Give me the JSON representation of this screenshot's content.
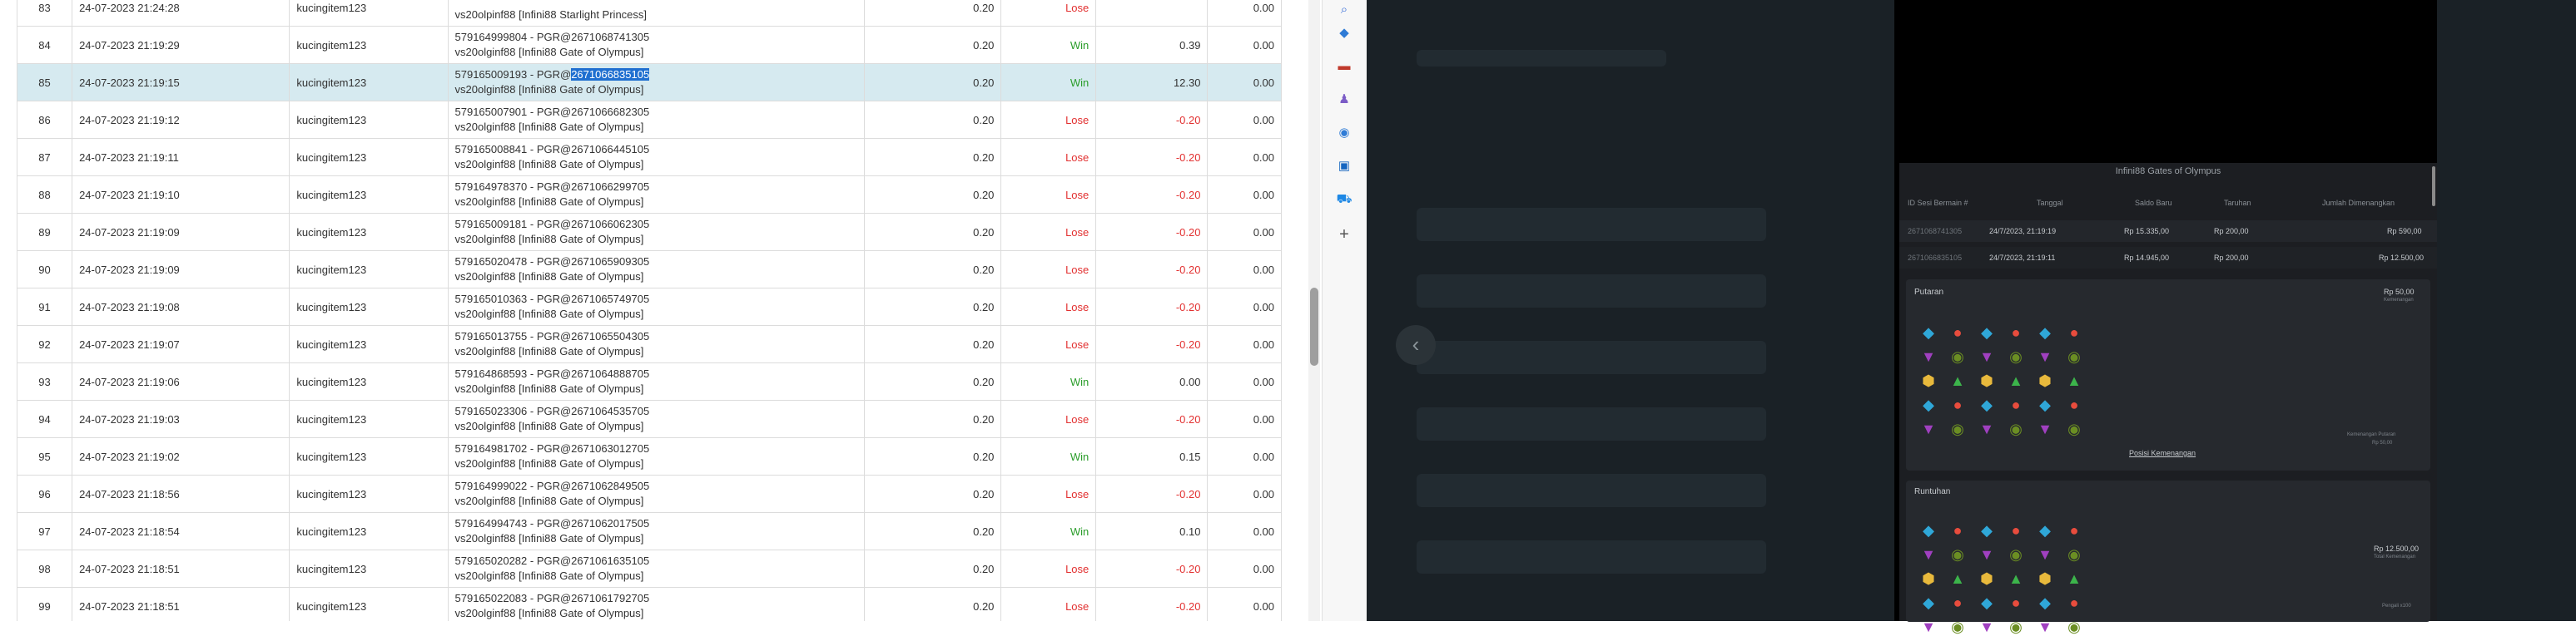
{
  "table": {
    "rows": [
      {
        "no": "83",
        "datetime": "24-07-2023 21:24:28",
        "user": "kucingitem123",
        "desc1": "",
        "desc2": "vs20olpinf88 [Infini88 Starlight Princess]",
        "bet": "0.20",
        "result": "Lose",
        "winloss": "",
        "balance": "0.00"
      },
      {
        "no": "84",
        "datetime": "24-07-2023 21:19:29",
        "user": "kucingitem123",
        "desc1": "579164999804 - PGR@2671068741305",
        "desc2": "vs20olginf88 [Infini88 Gate of Olympus]",
        "bet": "0.20",
        "result": "Win",
        "winloss": "0.39",
        "balance": "0.00"
      },
      {
        "no": "85",
        "datetime": "24-07-2023 21:19:15",
        "user": "kucingitem123",
        "desc1a": "579165009193 - PGR@",
        "desc1b": "2671066835105",
        "desc2": "vs20olginf88 [Infini88 Gate of Olympus]",
        "bet": "0.20",
        "result": "Win",
        "winloss": "12.30",
        "balance": "0.00"
      },
      {
        "no": "86",
        "datetime": "24-07-2023 21:19:12",
        "user": "kucingitem123",
        "desc1": "579165007901 - PGR@2671066682305",
        "desc2": "vs20olginf88 [Infini88 Gate of Olympus]",
        "bet": "0.20",
        "result": "Lose",
        "winloss": "-0.20",
        "balance": "0.00"
      },
      {
        "no": "87",
        "datetime": "24-07-2023 21:19:11",
        "user": "kucingitem123",
        "desc1": "579165008841 - PGR@2671066445105",
        "desc2": "vs20olginf88 [Infini88 Gate of Olympus]",
        "bet": "0.20",
        "result": "Lose",
        "winloss": "-0.20",
        "balance": "0.00"
      },
      {
        "no": "88",
        "datetime": "24-07-2023 21:19:10",
        "user": "kucingitem123",
        "desc1": "579164978370 - PGR@2671066299705",
        "desc2": "vs20olginf88 [Infini88 Gate of Olympus]",
        "bet": "0.20",
        "result": "Lose",
        "winloss": "-0.20",
        "balance": "0.00"
      },
      {
        "no": "89",
        "datetime": "24-07-2023 21:19:09",
        "user": "kucingitem123",
        "desc1": "579165009181 - PGR@2671066062305",
        "desc2": "vs20olginf88 [Infini88 Gate of Olympus]",
        "bet": "0.20",
        "result": "Lose",
        "winloss": "-0.20",
        "balance": "0.00"
      },
      {
        "no": "90",
        "datetime": "24-07-2023 21:19:09",
        "user": "kucingitem123",
        "desc1": "579165020478 - PGR@2671065909305",
        "desc2": "vs20olginf88 [Infini88 Gate of Olympus]",
        "bet": "0.20",
        "result": "Lose",
        "winloss": "-0.20",
        "balance": "0.00"
      },
      {
        "no": "91",
        "datetime": "24-07-2023 21:19:08",
        "user": "kucingitem123",
        "desc1": "579165010363 - PGR@2671065749705",
        "desc2": "vs20olginf88 [Infini88 Gate of Olympus]",
        "bet": "0.20",
        "result": "Lose",
        "winloss": "-0.20",
        "balance": "0.00"
      },
      {
        "no": "92",
        "datetime": "24-07-2023 21:19:07",
        "user": "kucingitem123",
        "desc1": "579165013755 - PGR@2671065504305",
        "desc2": "vs20olginf88 [Infini88 Gate of Olympus]",
        "bet": "0.20",
        "result": "Lose",
        "winloss": "-0.20",
        "balance": "0.00"
      },
      {
        "no": "93",
        "datetime": "24-07-2023 21:19:06",
        "user": "kucingitem123",
        "desc1": "579164868593 - PGR@2671064888705",
        "desc2": "vs20olginf88 [Infini88 Gate of Olympus]",
        "bet": "0.20",
        "result": "Win",
        "winloss": "0.00",
        "balance": "0.00"
      },
      {
        "no": "94",
        "datetime": "24-07-2023 21:19:03",
        "user": "kucingitem123",
        "desc1": "579165023306 - PGR@2671064535705",
        "desc2": "vs20olginf88 [Infini88 Gate of Olympus]",
        "bet": "0.20",
        "result": "Lose",
        "winloss": "-0.20",
        "balance": "0.00"
      },
      {
        "no": "95",
        "datetime": "24-07-2023 21:19:02",
        "user": "kucingitem123",
        "desc1": "579164981702 - PGR@2671063012705",
        "desc2": "vs20olginf88 [Infini88 Gate of Olympus]",
        "bet": "0.20",
        "result": "Win",
        "winloss": "0.15",
        "balance": "0.00"
      },
      {
        "no": "96",
        "datetime": "24-07-2023 21:18:56",
        "user": "kucingitem123",
        "desc1": "579164999022 - PGR@2671062849505",
        "desc2": "vs20olginf88 [Infini88 Gate of Olympus]",
        "bet": "0.20",
        "result": "Lose",
        "winloss": "-0.20",
        "balance": "0.00"
      },
      {
        "no": "97",
        "datetime": "24-07-2023 21:18:54",
        "user": "kucingitem123",
        "desc1": "579164994743 - PGR@2671062017505",
        "desc2": "vs20olginf88 [Infini88 Gate of Olympus]",
        "bet": "0.20",
        "result": "Win",
        "winloss": "0.10",
        "balance": "0.00"
      },
      {
        "no": "98",
        "datetime": "24-07-2023 21:18:51",
        "user": "kucingitem123",
        "desc1": "579165020282 - PGR@2671061635105",
        "desc2": "vs20olginf88 [Infini88 Gate of Olympus]",
        "bet": "0.20",
        "result": "Lose",
        "winloss": "-0.20",
        "balance": "0.00"
      },
      {
        "no": "99",
        "datetime": "24-07-2023 21:18:51",
        "user": "kucingitem123",
        "desc1": "579165022083 - PGR@2671061792705",
        "desc2": "vs20olginf88 [Infini88 Gate of Olympus]",
        "bet": "0.20",
        "result": "Lose",
        "winloss": "-0.20",
        "balance": "0.00"
      }
    ]
  },
  "edge_bar": {
    "icons": [
      "search-icon",
      "tag-icon",
      "toolbox-icon",
      "people-icon",
      "copilot-icon",
      "outlook-icon",
      "cart-icon",
      "add-icon"
    ],
    "add_glyph": "+"
  },
  "nav": {
    "back_glyph": "‹"
  },
  "game": {
    "title": "Infini88 Gates of Olympus",
    "headers": {
      "round_id": "ID Sesi Bermain #",
      "date": "Tanggal",
      "balance": "Saldo Baru",
      "bet": "Taruhan",
      "win": "Jumlah Dimenangkan"
    },
    "rows": [
      {
        "id": "2671068741305",
        "date": "24/7/2023, 21:19:19",
        "balance": "Rp 15.335,00",
        "bet": "Rp 200,00",
        "win": "Rp 590,00"
      },
      {
        "id": "2671066835105",
        "date": "24/7/2023, 21:19:11",
        "balance": "Rp 14.945,00",
        "bet": "Rp 200,00",
        "win": "Rp 12.500,00"
      }
    ],
    "putaran": {
      "label": "Putaran",
      "amount": "Rp 50,00",
      "amount_sub": "Kemenangan",
      "side_small1": "Kemenangan Putaran",
      "side_small2": "Rp 50,00",
      "link": "Posisi Kemenangan"
    },
    "runtuhan": {
      "label": "Runtuhan",
      "amount": "Rp 12.500,00",
      "amount_sub": "Total Kemenangan",
      "bottom_small": "Pengali x100"
    },
    "colors": {
      "panel": "#1c1e22",
      "accent": "#e8b93c"
    }
  }
}
